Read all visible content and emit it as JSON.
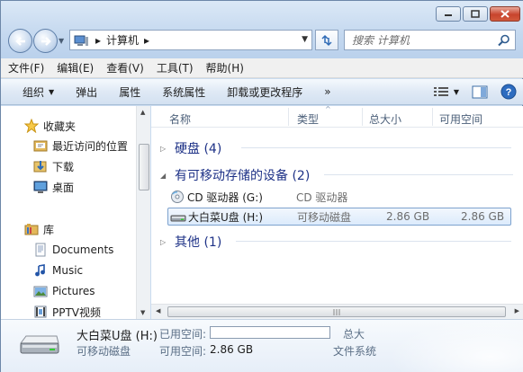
{
  "window": {
    "address": {
      "root_label": "计算机"
    },
    "search": {
      "placeholder": "搜索 计算机"
    }
  },
  "menubar": {
    "items": [
      "文件(F)",
      "编辑(E)",
      "查看(V)",
      "工具(T)",
      "帮助(H)"
    ]
  },
  "commandbar": {
    "items": [
      "组织",
      "弹出",
      "属性",
      "系统属性",
      "卸载或更改程序"
    ],
    "more": "»"
  },
  "navpane": {
    "items": [
      {
        "label": "收藏夹",
        "icon": "star-icon"
      },
      {
        "label": "最近访问的位置",
        "icon": "recent-places-icon"
      },
      {
        "label": "下载",
        "icon": "downloads-icon"
      },
      {
        "label": "桌面",
        "icon": "desktop-icon"
      },
      {
        "label": "库",
        "icon": "libraries-icon"
      },
      {
        "label": "Documents",
        "icon": "documents-icon"
      },
      {
        "label": "Music",
        "icon": "music-icon"
      },
      {
        "label": "Pictures",
        "icon": "pictures-icon"
      },
      {
        "label": "PPTV视频",
        "icon": "video-icon"
      }
    ]
  },
  "columns": [
    "名称",
    "类型",
    "总大小",
    "可用空间"
  ],
  "groups": [
    {
      "label": "硬盘 (4)",
      "expanded": false
    },
    {
      "label": "有可移动存储的设备 (2)",
      "expanded": true
    },
    {
      "label": "其他 (1)",
      "expanded": false
    }
  ],
  "devices": [
    {
      "name": "CD 驱动器 (G:)",
      "type": "CD 驱动器",
      "total": "",
      "free": "",
      "icon": "cd-drive-icon",
      "selected": false
    },
    {
      "name": "大白菜U盘 (H:)",
      "type": "可移动磁盘",
      "total": "2.86 GB",
      "free": "2.86 GB",
      "icon": "usb-drive-icon",
      "selected": true
    }
  ],
  "details": {
    "name": "大白菜U盘 (H:)",
    "type": "可移动磁盘",
    "used_label": "已用空间:",
    "free_label": "可用空间:",
    "free_value": "2.86 GB",
    "total_label": "总大",
    "fs_label": "文件系统",
    "used_fraction": 0.0
  }
}
